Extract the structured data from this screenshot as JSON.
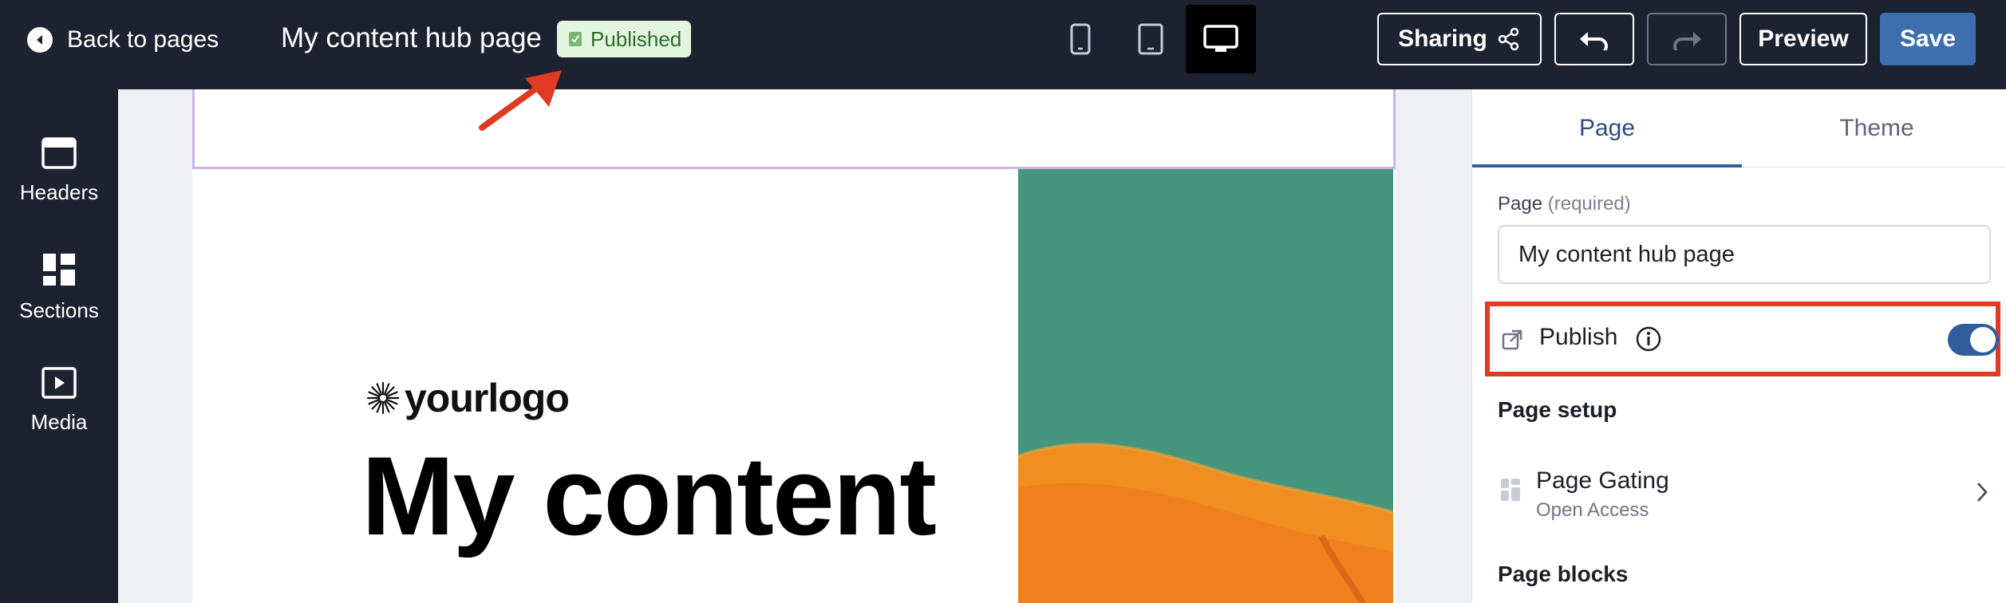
{
  "topbar": {
    "back_label": "Back to pages",
    "page_title": "My content hub page",
    "status_badge": "Published",
    "devices": [
      "mobile-icon",
      "tablet-icon",
      "desktop-icon"
    ],
    "active_device": "desktop",
    "sharing_label": "Sharing",
    "preview_label": "Preview",
    "save_label": "Save"
  },
  "sidebar": {
    "items": [
      {
        "label": "Headers",
        "icon": "headers-icon"
      },
      {
        "label": "Sections",
        "icon": "sections-icon"
      },
      {
        "label": "Media",
        "icon": "media-icon"
      }
    ]
  },
  "canvas": {
    "logo_text": "yourlogo",
    "hero_title": "My content"
  },
  "panel": {
    "tabs": [
      "Page",
      "Theme"
    ],
    "active_tab": "Page",
    "page_field_label": "Page",
    "page_field_required": "(required)",
    "page_field_value": "My content hub page",
    "publish_label": "Publish",
    "publish_on": true,
    "page_setup_heading": "Page setup",
    "gating_title": "Page Gating",
    "gating_value": "Open Access",
    "page_blocks_heading": "Page blocks"
  },
  "colors": {
    "topbar_bg": "#1d2231",
    "save_button": "#3d6faf",
    "toggle_on": "#2f5e9a",
    "badge_bg": "#e3f4df",
    "badge_text": "#2f6b2c",
    "annotation": "#e03a22"
  }
}
